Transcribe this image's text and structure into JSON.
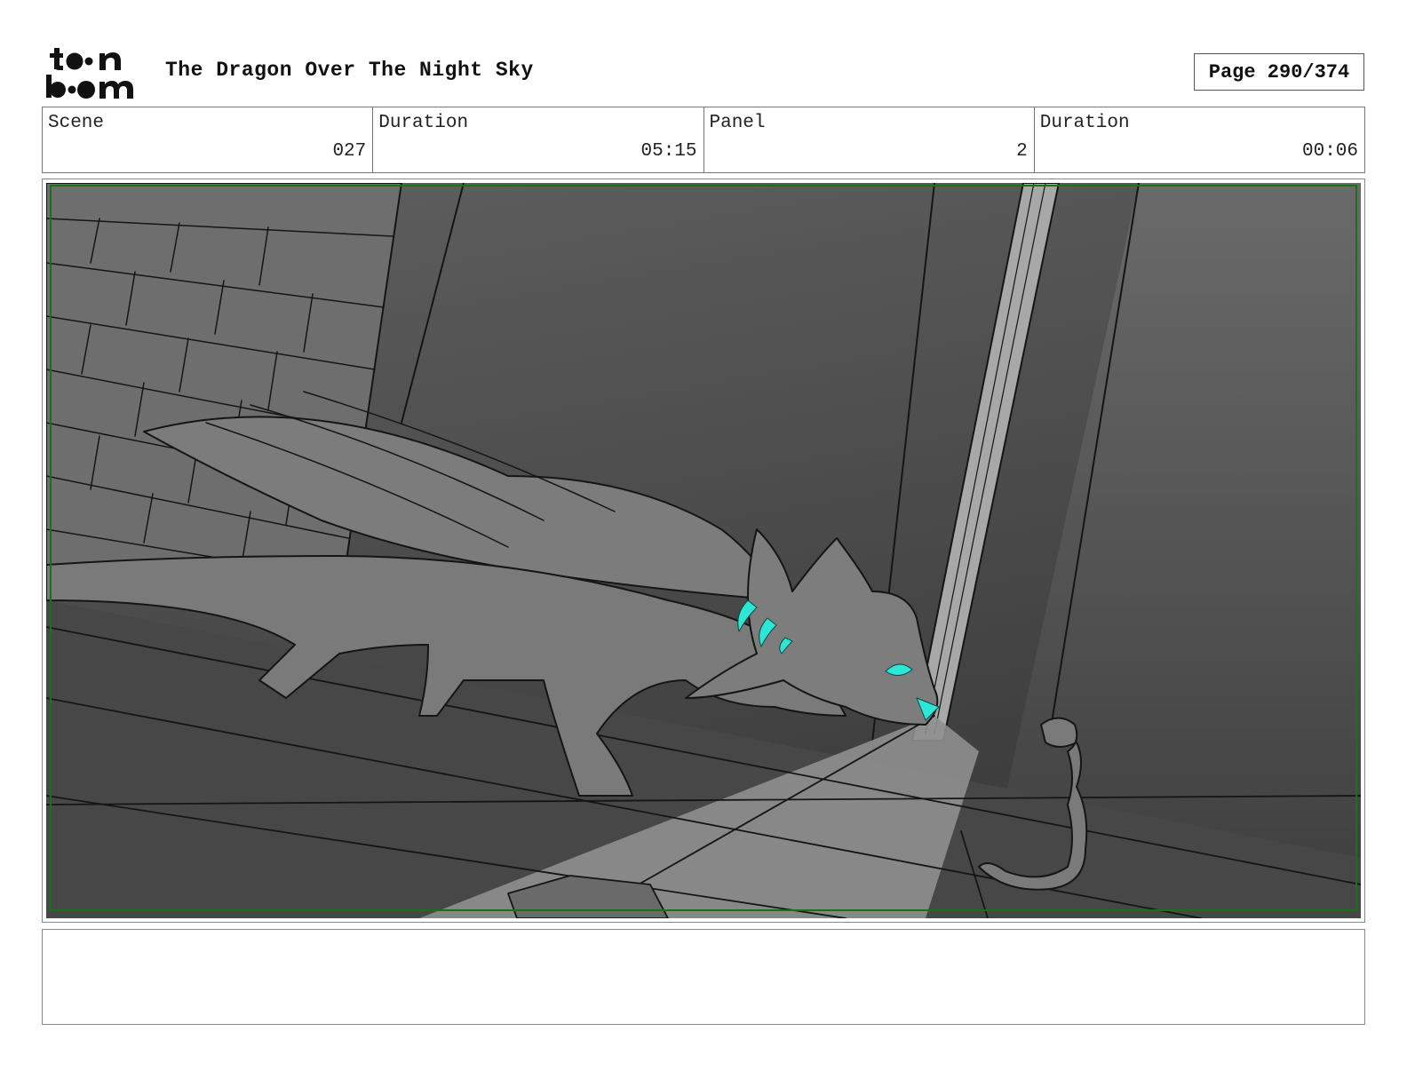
{
  "header": {
    "logo_text": "toon boom",
    "title": "The Dragon Over The Night Sky",
    "page": "Page 290/374"
  },
  "info": {
    "scene_label": "Scene",
    "scene_value": "027",
    "scene_duration_label": "Duration",
    "scene_duration_value": "05:15",
    "panel_label": "Panel",
    "panel_value": "2",
    "panel_duration_label": "Duration",
    "panel_duration_value": "00:06"
  },
  "panel": {
    "colors": {
      "background_dark": "#3f3f3f",
      "background_mid": "#5a5a5a",
      "creature_fill": "#7b7b7b",
      "light_beam": "#9a9a9a",
      "glow": "#2ee6d6",
      "safe_frame": "#1f6e1f"
    }
  },
  "notes": {
    "text": ""
  }
}
